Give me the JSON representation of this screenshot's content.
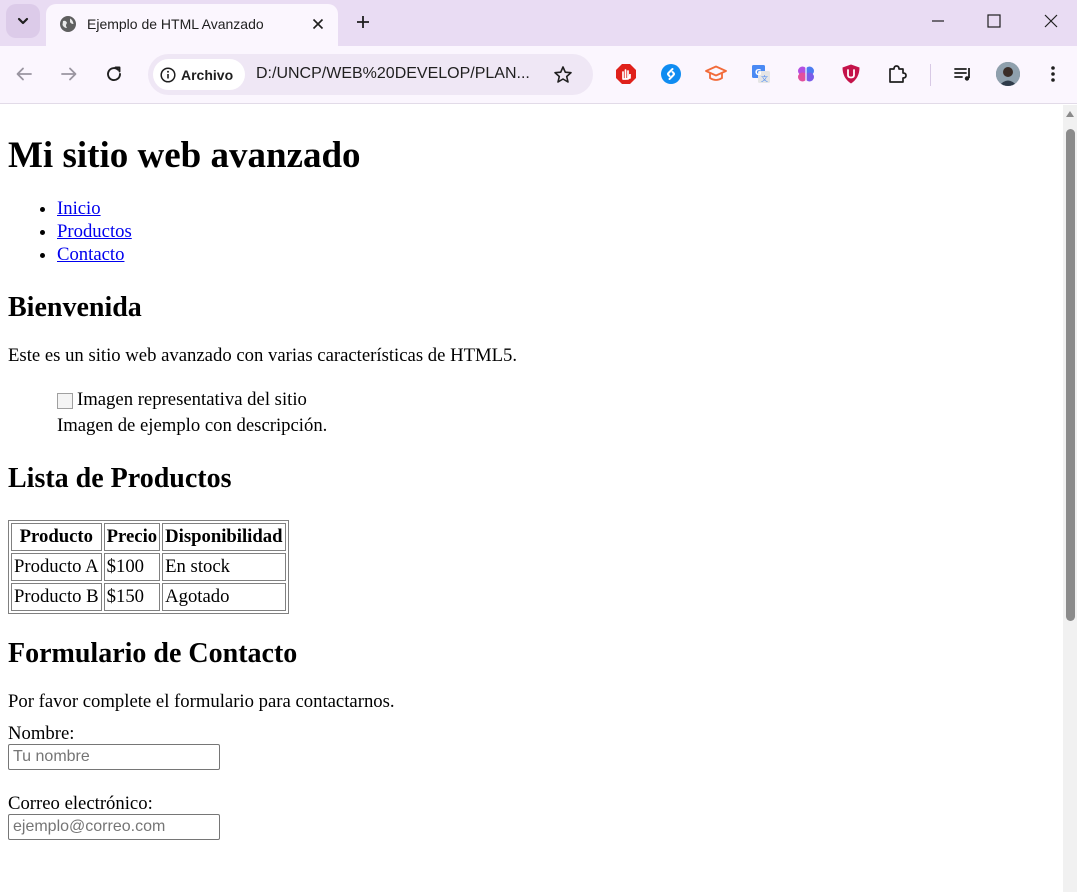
{
  "browser": {
    "tab_title": "Ejemplo de HTML Avanzado",
    "site_info_label": "Archivo",
    "url": "D:/UNCP/WEB%20DEVELOP/PLAN...",
    "colors": {
      "tabstrip": "#e9dcf3",
      "toolbar": "#fbf6fe",
      "omnibox": "#efe7f5"
    },
    "icons": {
      "tab_search": "chevron-down-icon",
      "favicon": "globe-icon",
      "tab_close": "close-icon",
      "new_tab": "plus-icon",
      "minimize": "minimize-icon",
      "maximize": "maximize-icon",
      "close_window": "close-window-icon",
      "back": "back-arrow-icon",
      "forward": "forward-arrow-icon",
      "reload": "reload-icon",
      "site_info": "info-icon",
      "bookmark": "star-icon",
      "extensions": [
        "adblock-icon",
        "shazam-icon",
        "graduation-cap-icon",
        "google-translate-icon",
        "brain-icon",
        "ublock-shield-icon",
        "puzzle-extensions-icon"
      ],
      "media": "media-queue-icon",
      "profile": "avatar",
      "menu": "kebab-menu-icon"
    }
  },
  "page": {
    "title": "Mi sitio web avanzado",
    "nav": [
      "Inicio",
      "Productos",
      "Contacto"
    ],
    "welcome": {
      "heading": "Bienvenida",
      "text": "Este es un sitio web avanzado con varias características de HTML5.",
      "image_alt": "Imagen representativa del sitio",
      "caption": "Imagen de ejemplo con descripción."
    },
    "products": {
      "heading": "Lista de Productos",
      "columns": [
        "Producto",
        "Precio",
        "Disponibilidad"
      ],
      "rows": [
        [
          "Producto A",
          "$100",
          "En stock"
        ],
        [
          "Producto B",
          "$150",
          "Agotado"
        ]
      ]
    },
    "contact": {
      "heading": "Formulario de Contacto",
      "intro": "Por favor complete el formulario para contactarnos.",
      "name_label": "Nombre:",
      "name_placeholder": "Tu nombre",
      "email_label": "Correo electrónico:",
      "email_placeholder": "ejemplo@correo.com"
    }
  }
}
